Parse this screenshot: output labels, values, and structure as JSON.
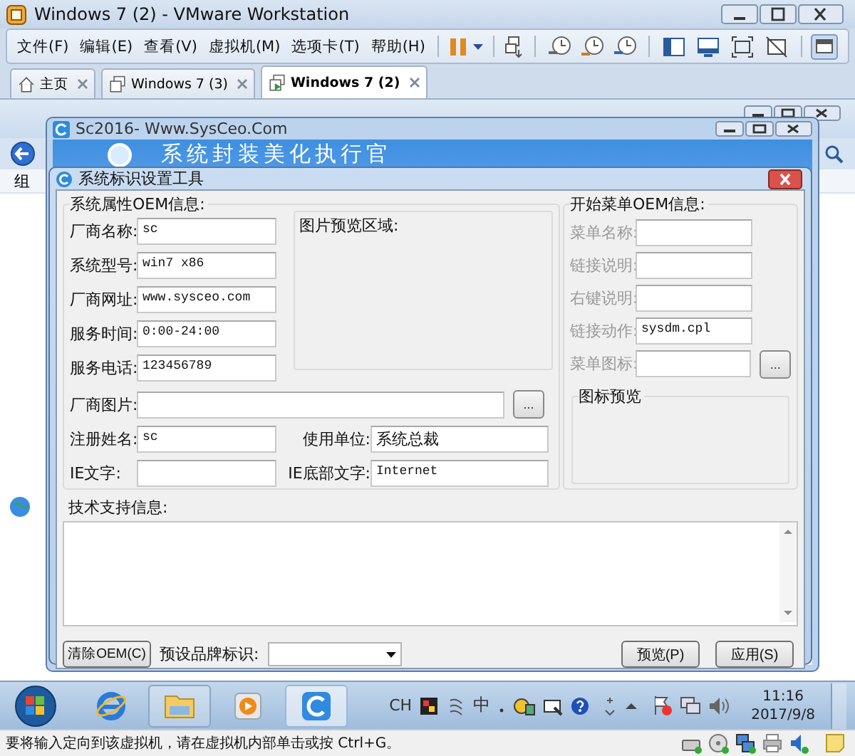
{
  "window": {
    "title": "Windows 7 (2) - VMware Workstation"
  },
  "menu": [
    {
      "label": "文件(F)"
    },
    {
      "label": "编辑(E)"
    },
    {
      "label": "查看(V)"
    },
    {
      "label": "虚拟机(M)"
    },
    {
      "label": "选项卡(T)"
    },
    {
      "label": "帮助(H)"
    }
  ],
  "tabs": [
    {
      "label": "主页",
      "kind": "home",
      "selected": false
    },
    {
      "label": "Windows 7 (3)",
      "kind": "vm",
      "selected": false
    },
    {
      "label": "Windows 7 (2)",
      "kind": "vm-running",
      "selected": true
    }
  ],
  "guest": {
    "background_window": {
      "toolbar_text": "组"
    },
    "app_window": {
      "title": "Sc2016- Www.SysCeo.Com",
      "banner": "系统封装美化执行官"
    },
    "dialog": {
      "title": "系统标识设置工具",
      "oem_group": {
        "title": "系统属性OEM信息:",
        "fields": [
          {
            "label": "厂商名称:",
            "value": "sc"
          },
          {
            "label": "系统型号:",
            "value": "win7 x86"
          },
          {
            "label": "厂商网址:",
            "value": "www.sysceo.com"
          },
          {
            "label": "服务时间:",
            "value": "0:00-24:00"
          },
          {
            "label": "服务电话:",
            "value": "123456789"
          }
        ],
        "preview_label": "图片预览区域:",
        "image_field": {
          "label": "厂商图片:",
          "browse": "..."
        },
        "pairs": [
          {
            "label": "注册姓名:",
            "value": "sc"
          },
          {
            "label": "使用单位:",
            "value": "系统总裁"
          },
          {
            "label": "IE文字:"
          },
          {
            "label": "IE底部文字:",
            "value": "Internet"
          }
        ]
      },
      "start_menu_group": {
        "title": "开始菜单OEM信息:",
        "fields": [
          {
            "label": "菜单名称:",
            "disabled": true
          },
          {
            "label": "链接说明:",
            "disabled": true
          },
          {
            "label": "右键说明:",
            "disabled": true
          },
          {
            "label": "链接动作:",
            "disabled": true,
            "value": "sysdm.cpl"
          },
          {
            "label": "菜单图标:",
            "disabled": true,
            "browse": "..."
          }
        ],
        "icon_preview_label": "图标预览"
      },
      "support": {
        "label": "技术支持信息:"
      },
      "footer": {
        "clear_button": "清除OEM(C)",
        "preset_label": "预设品牌标识:",
        "preview_button": "预览(P)",
        "apply_button": "应用(S)"
      }
    }
  },
  "taskbar": {
    "apps": [
      {
        "kind": "browser",
        "running": false,
        "selected": false
      },
      {
        "kind": "folder",
        "running": true,
        "selected": false
      },
      {
        "kind": "media",
        "running": false,
        "selected": false
      },
      {
        "kind": "app",
        "running": true,
        "selected": true
      }
    ],
    "language": "CH",
    "ime": "中",
    "time": "11:16",
    "date": "2017/9/8"
  },
  "status_bar": {
    "text": "要将输入定向到该虚拟机，请在虚拟机内部单击或按 Ctrl+G。"
  }
}
